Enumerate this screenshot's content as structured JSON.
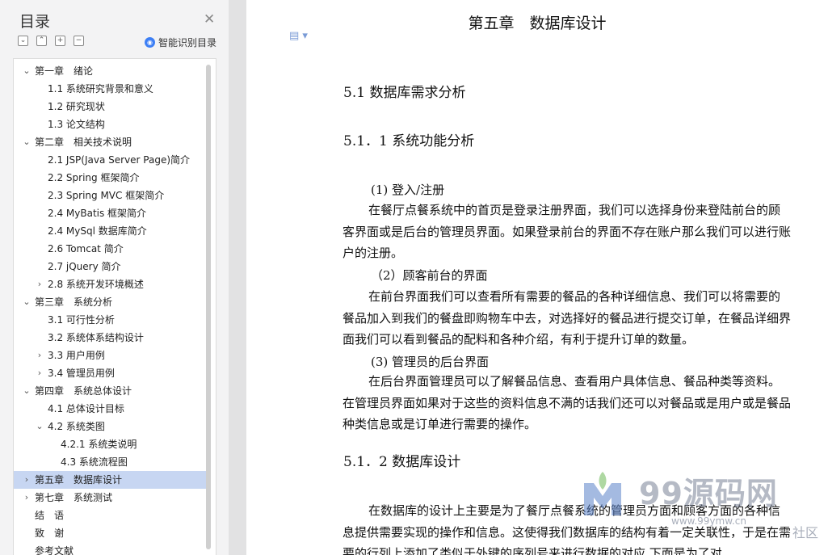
{
  "sidebar": {
    "title": "目录",
    "smart_label": "智能识别目录",
    "toc": [
      {
        "label": "第一章　绪论",
        "level": 1,
        "arrow": "⌄"
      },
      {
        "label": "1.1 系统研究背景和意义",
        "level": 2,
        "arrow": ""
      },
      {
        "label": "1.2 研究现状",
        "level": 2,
        "arrow": ""
      },
      {
        "label": "1.3 论文结构",
        "level": 2,
        "arrow": ""
      },
      {
        "label": "第二章　相关技术说明",
        "level": 1,
        "arrow": "⌄"
      },
      {
        "label": "2.1 JSP(Java Server Page)简介",
        "level": 2,
        "arrow": ""
      },
      {
        "label": "2.2 Spring 框架简介",
        "level": 2,
        "arrow": ""
      },
      {
        "label": "2.3 Spring MVC 框架简介",
        "level": 2,
        "arrow": ""
      },
      {
        "label": "2.4 MyBatis 框架简介",
        "level": 2,
        "arrow": ""
      },
      {
        "label": "2.4 MySql 数据库简介",
        "level": 2,
        "arrow": ""
      },
      {
        "label": "2.6 Tomcat 简介",
        "level": 2,
        "arrow": ""
      },
      {
        "label": "2.7 jQuery 简介",
        "level": 2,
        "arrow": ""
      },
      {
        "label": "2.8 系统开发环境概述",
        "level": 2,
        "arrow": "›"
      },
      {
        "label": "第三章　系统分析",
        "level": 1,
        "arrow": "⌄"
      },
      {
        "label": "3.1 可行性分析",
        "level": 2,
        "arrow": ""
      },
      {
        "label": "3.2 系统体系结构设计",
        "level": 2,
        "arrow": ""
      },
      {
        "label": "3.3 用户用例",
        "level": 2,
        "arrow": "›"
      },
      {
        "label": "3.4 管理员用例",
        "level": 2,
        "arrow": "›"
      },
      {
        "label": "第四章　系统总体设计",
        "level": 1,
        "arrow": "⌄"
      },
      {
        "label": "4.1 总体设计目标",
        "level": 2,
        "arrow": ""
      },
      {
        "label": "4.2 系统类图",
        "level": 2,
        "arrow": "⌄"
      },
      {
        "label": "4.2.1 系统类说明",
        "level": 3,
        "arrow": ""
      },
      {
        "label": "4.3 系统流程图",
        "level": 3,
        "arrow": ""
      },
      {
        "label": "第五章　数据库设计",
        "level": 1,
        "arrow": "›",
        "selected": true
      },
      {
        "label": "第七章　系统测试",
        "level": 1,
        "arrow": "›"
      },
      {
        "label": "结　语",
        "level": 1,
        "arrow": ""
      },
      {
        "label": "致　谢",
        "level": 1,
        "arrow": ""
      },
      {
        "label": "参考文献",
        "level": 1,
        "arrow": ""
      }
    ]
  },
  "doc": {
    "chapter_title": "第五章　数据库设计",
    "h_51": "5.1 数据库需求分析",
    "h_511": "5.1．1 系统功能分析",
    "item1": "(1) 登入/注册",
    "para1": "在餐厅点餐系统中的首页是登录注册界面，我们可以选择身份来登陆前台的顾客界面或是后台的管理员界面。如果登录前台的界面不存在账户那么我们可以进行账户的注册。",
    "item2": "（2）顾客前台的界面",
    "para2": "在前台界面我们可以查看所有需要的餐品的各种详细信息、我们可以将需要的餐品加入到我们的餐盘即购物车中去，对选择好的餐品进行提交订单，在餐品详细界面我们可以看到餐品的配料和各种介绍，有利于提升订单的数量。",
    "item3": "(3) 管理员的后台界面",
    "para3": "在后台界面管理员可以了解餐品信息、查看用户具体信息、餐品种类等资料。在管理员界面如果对于这些的资料信息不满的话我们还可以对餐品或是用户或是餐品种类信息或是订单进行需要的操作。",
    "h_512": "5.1．2 数据库设计",
    "para4": "在数据库的设计上主要是为了餐厅点餐系统的管理员方面和顾客方面的各种信息提供需要实现的操作和信息。这使得我们数据库的结构有着一定关联性，于是在需要的行列上添加了类似于外键的序列号来进行数据的对应,下面是为了对"
  },
  "watermark": {
    "text": "99源码网",
    "url": "www.99ymw.cn",
    "corner": "社区"
  }
}
